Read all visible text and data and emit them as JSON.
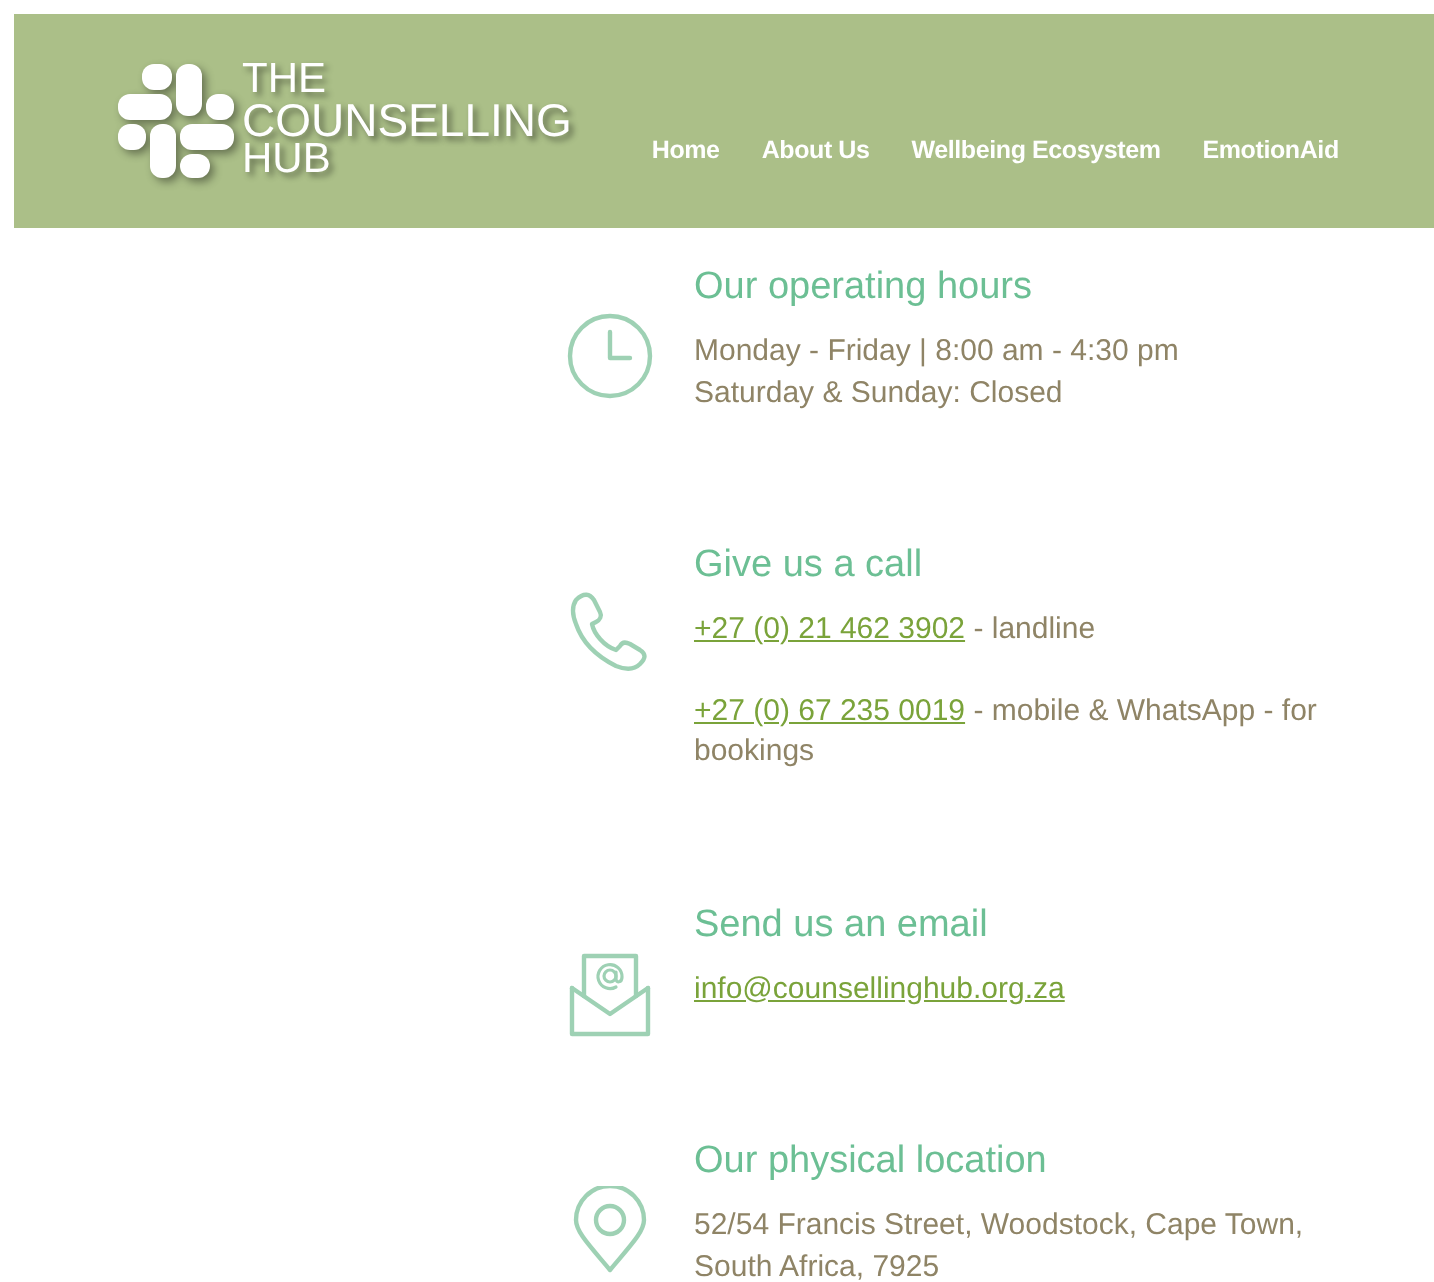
{
  "header": {
    "logo": {
      "lines": [
        "THE",
        "COUNSELLING",
        "HUB"
      ]
    },
    "nav": [
      {
        "label": "Home"
      },
      {
        "label": "About Us"
      },
      {
        "label": "Wellbeing Ecosystem"
      },
      {
        "label": "EmotionAid"
      }
    ]
  },
  "sections": [
    {
      "kind": "hours",
      "heading": "Our operating hours",
      "paragraphs": [
        {
          "lines": [
            [
              {
                "text": "Monday - Friday | 8:00 am - 4:30 pm"
              }
            ],
            [
              {
                "text": "Saturday & Sunday: Closed"
              }
            ]
          ]
        }
      ]
    },
    {
      "kind": "phone",
      "heading": "Give us a call",
      "paragraphs": [
        {
          "lines": [
            [
              {
                "link": "+27 (0) 21 462 3902"
              },
              {
                "text": " - landline"
              }
            ]
          ]
        },
        {
          "lines": [
            [
              {
                "link": "+27 (0) 67 235 0019"
              },
              {
                "text": " - mobile & WhatsApp - for bookings"
              }
            ]
          ]
        }
      ]
    },
    {
      "kind": "email",
      "heading": "Send us an email",
      "paragraphs": [
        {
          "lines": [
            [
              {
                "link": "info@counsellinghub.org.za"
              }
            ]
          ]
        }
      ]
    },
    {
      "kind": "location",
      "heading": "Our physical location",
      "paragraphs": [
        {
          "lines": [
            [
              {
                "text": "52/54 Francis Street, Woodstock, Cape Town, South Africa, 7925"
              }
            ]
          ]
        }
      ]
    }
  ]
}
